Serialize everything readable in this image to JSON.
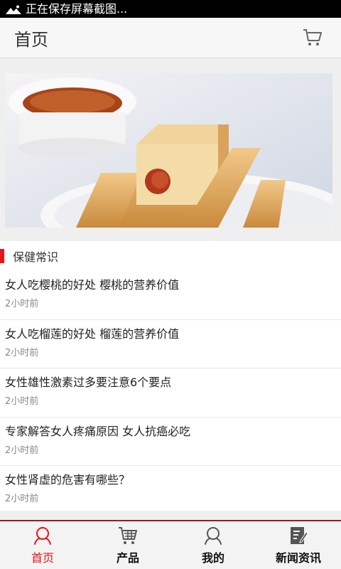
{
  "status_bar": {
    "text": "正在保存屏幕截图..."
  },
  "header": {
    "title": "首页"
  },
  "section": {
    "title": "保健常识",
    "items": [
      {
        "title": "女人吃樱桃的好处 樱桃的营养价值",
        "time": "2小时前"
      },
      {
        "title": "女人吃榴莲的好处 榴莲的营养价值",
        "time": "2小时前"
      },
      {
        "title": "女性雄性激素过多要注意6个要点",
        "time": "2小时前"
      },
      {
        "title": "专家解答女人疼痛原因 女人抗癌必吃",
        "time": "2小时前"
      },
      {
        "title": "女性肾虚的危害有哪些？",
        "time": "2小时前"
      }
    ]
  },
  "bottom_nav": {
    "items": [
      {
        "label": "首页",
        "icon": "home-person-icon",
        "active": true
      },
      {
        "label": "产品",
        "icon": "cart-icon",
        "active": false
      },
      {
        "label": "我的",
        "icon": "user-icon",
        "active": false
      },
      {
        "label": "新闻资讯",
        "icon": "news-edit-icon",
        "active": false
      }
    ]
  },
  "colors": {
    "accent": "#e4151b",
    "nav_border": "#a9141b"
  }
}
